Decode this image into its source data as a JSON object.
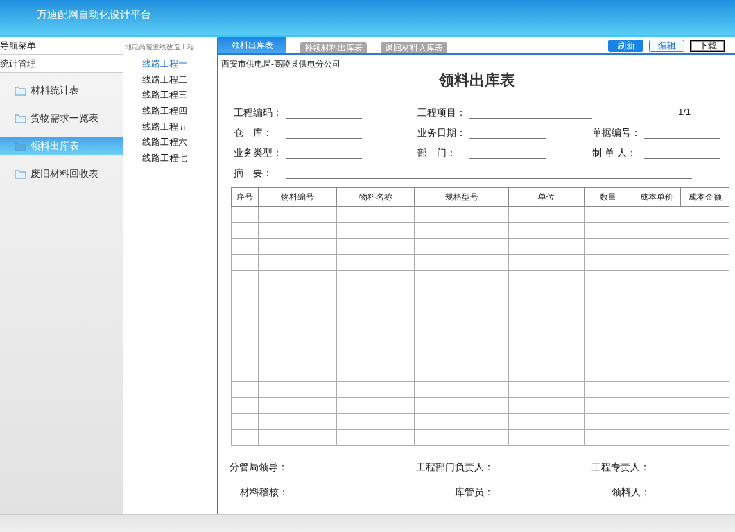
{
  "header": {
    "title": "万迪配网自动化设计平台"
  },
  "sidebar": {
    "heading": "导航菜单",
    "section": "统计管理",
    "items": [
      {
        "label": "材料统计表",
        "selected": false
      },
      {
        "label": "货物需求一览表",
        "selected": false
      },
      {
        "label": "领料出库表",
        "selected": true
      },
      {
        "label": "废旧材料回收表",
        "selected": false
      }
    ]
  },
  "projects": {
    "heading": "地电高陵主线改造工程",
    "items": [
      {
        "label": "线路工程一",
        "selected": true
      },
      {
        "label": "线路工程二",
        "selected": false
      },
      {
        "label": "线路工程三",
        "selected": false
      },
      {
        "label": "线路工程四",
        "selected": false
      },
      {
        "label": "线路工程五",
        "selected": false
      },
      {
        "label": "线路工程六",
        "selected": false
      },
      {
        "label": "线路工程七",
        "selected": false
      }
    ]
  },
  "tabs": [
    {
      "label": "领料出库表",
      "selected": true
    },
    {
      "label": "补领材料出库表",
      "selected": false
    },
    {
      "label": "退回材料入库表",
      "selected": false
    }
  ],
  "buttons": [
    {
      "label": "刷新",
      "kind": "primary"
    },
    {
      "label": "编辑",
      "kind": "outline"
    },
    {
      "label": "下载",
      "kind": "plain"
    }
  ],
  "document": {
    "company": "西安市供电局-高陵县供电分公司",
    "title": "领料出库表",
    "page": "1/1",
    "field_rows": [
      [
        {
          "label": "工程编码：",
          "kind": "short"
        },
        {
          "label": "工程项目：",
          "kind": "long"
        }
      ],
      [
        {
          "label": "仓　库：",
          "kind": "short"
        },
        {
          "label": "业务日期：",
          "kind": "short"
        },
        {
          "label": "单据编号：",
          "kind": "short"
        }
      ],
      [
        {
          "label": "业务类型：",
          "kind": "short"
        },
        {
          "label": "部　门：",
          "kind": "short"
        },
        {
          "label": "制 单 人：",
          "kind": "short"
        }
      ]
    ],
    "summary_label": "摘　要：",
    "table": {
      "columns": [
        "序号",
        "物料编号",
        "物料名称",
        "规格型号",
        "单位",
        "数量",
        "成本单价",
        "成本金额"
      ]
    },
    "signatures": [
      [
        "分管局领导：",
        "工程部门负责人：",
        "工程专责人："
      ],
      [
        "材料稽核：",
        "库管员：",
        "领料人："
      ]
    ]
  }
}
